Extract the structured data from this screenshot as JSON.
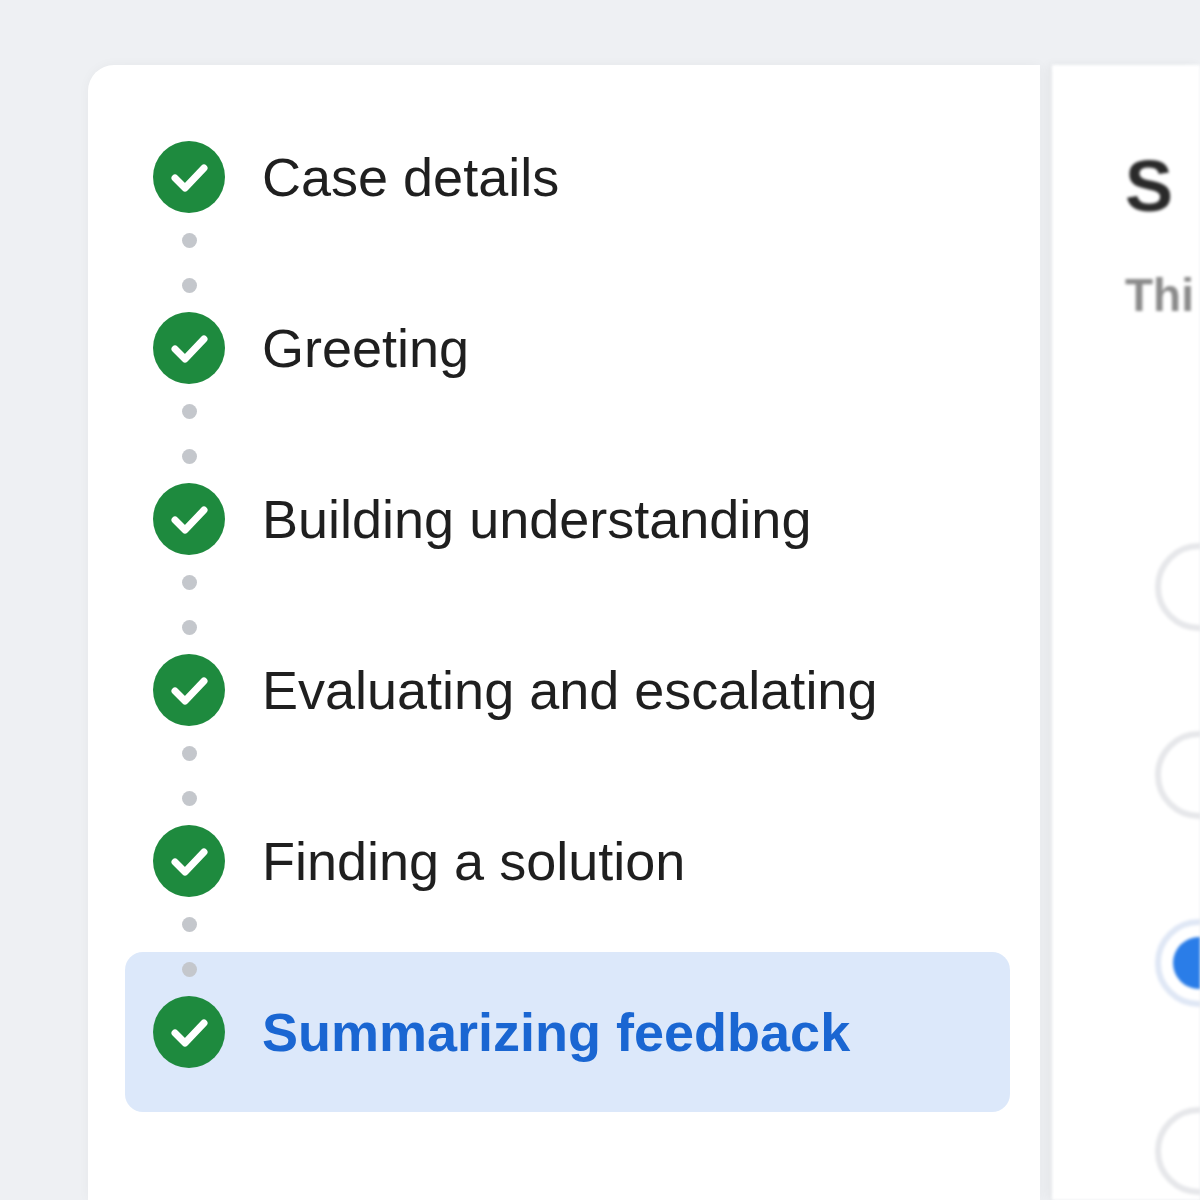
{
  "steps": [
    {
      "label": "Case details",
      "completed": true,
      "selected": false
    },
    {
      "label": "Greeting",
      "completed": true,
      "selected": false
    },
    {
      "label": "Building understanding",
      "completed": true,
      "selected": false
    },
    {
      "label": "Evaluating and escalating",
      "completed": true,
      "selected": false
    },
    {
      "label": "Finding a solution",
      "completed": true,
      "selected": false
    },
    {
      "label": "Summarizing feedback",
      "completed": true,
      "selected": true
    }
  ],
  "panel": {
    "title": "S",
    "subtitle": "Thi",
    "options": [
      {
        "selected": false
      },
      {
        "selected": false
      },
      {
        "selected": true
      },
      {
        "selected": false
      }
    ]
  }
}
